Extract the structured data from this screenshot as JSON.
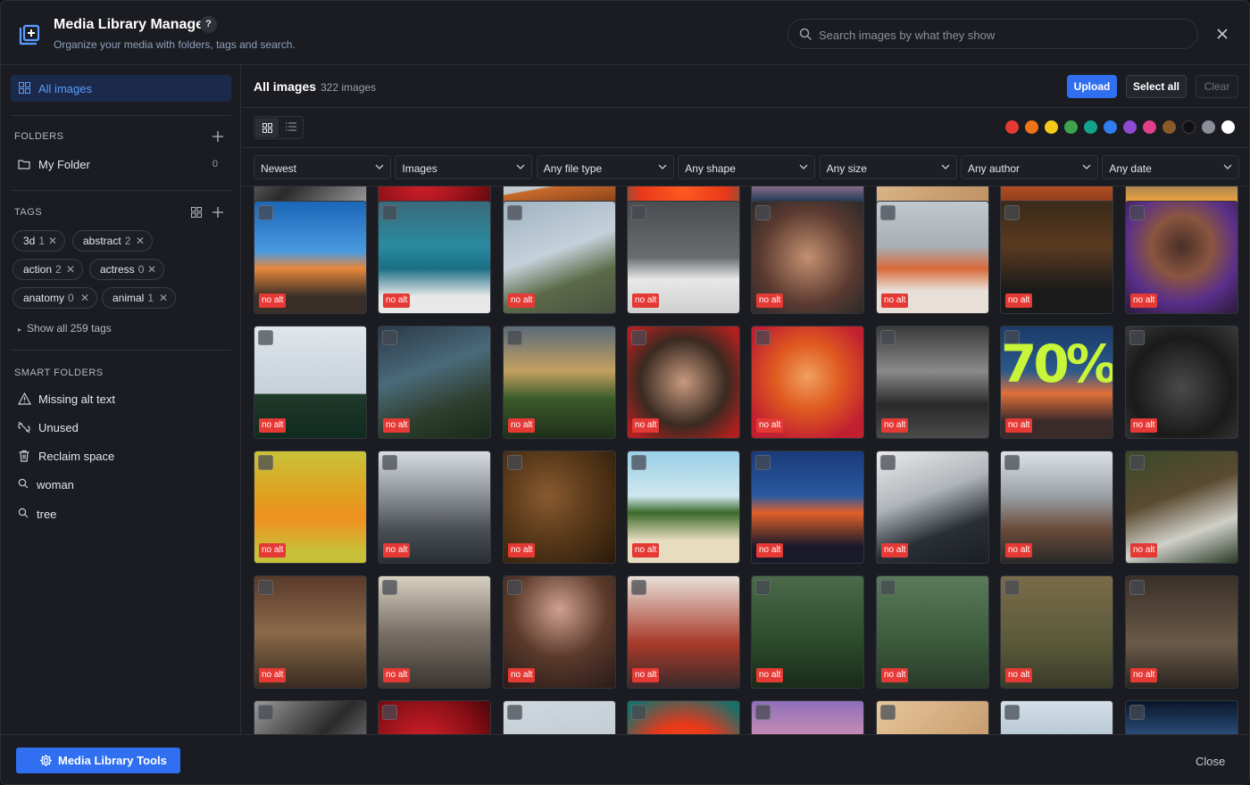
{
  "header": {
    "title": "Media Library Manager",
    "help_label": "?",
    "subtitle": "Organize your media with folders, tags and search.",
    "search_placeholder": "Search images by what they show"
  },
  "sidebar": {
    "all_images_label": "All images",
    "folders_heading": "FOLDERS",
    "folders": [
      {
        "name": "My Folder",
        "count": "0"
      }
    ],
    "tags_heading": "TAGS",
    "tags": [
      {
        "name": "3d",
        "count": "1"
      },
      {
        "name": "abstract",
        "count": "2"
      },
      {
        "name": "action",
        "count": "2"
      },
      {
        "name": "actress",
        "count": "0"
      },
      {
        "name": "anatomy",
        "count": "0"
      },
      {
        "name": "animal",
        "count": "1"
      }
    ],
    "show_all_tags": "Show all 259 tags",
    "smart_heading": "SMART FOLDERS",
    "smart_folders": [
      "Missing alt text",
      "Unused",
      "Reclaim space",
      "woman",
      "tree"
    ]
  },
  "main": {
    "title": "All images",
    "count_label": "322 images",
    "upload_label": "Upload",
    "select_all_label": "Select all",
    "clear_label": "Clear",
    "color_filters": [
      "#e53935",
      "#f0731a",
      "#f5c91a",
      "#3fa34d",
      "#14a48a",
      "#2f7df0",
      "#8e4ad1",
      "#e0408a",
      "#8a5a2b",
      "#111111",
      "#8b8f99",
      "#ffffff"
    ],
    "filters": [
      "Newest",
      "Images",
      "Any file type",
      "Any shape",
      "Any size",
      "Any author",
      "Any date"
    ],
    "no_alt_label": "no alt",
    "tile_overlay_text": "70%"
  },
  "footer": {
    "tools_label": "Media Library Tools",
    "close_label": "Close"
  }
}
